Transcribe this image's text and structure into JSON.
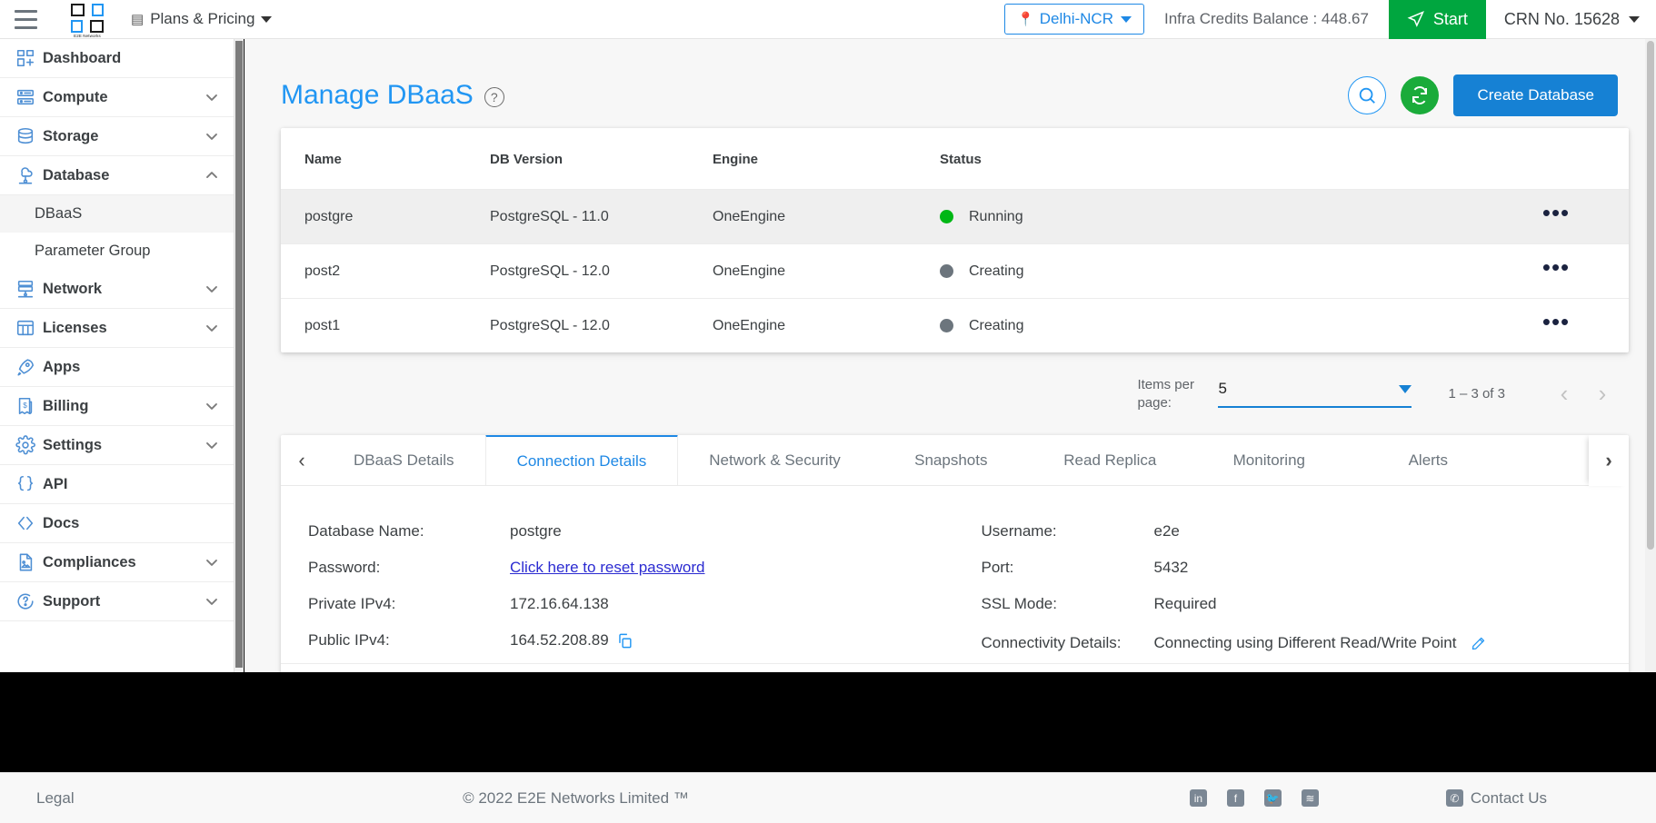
{
  "topbar": {
    "menu_icon": "hamburger-icon",
    "logo_caption": "E2E Networks",
    "plans_label": "Plans & Pricing",
    "region_label": "Delhi-NCR",
    "credits_label": "Infra Credits Balance : 448.67",
    "start_label": "Start",
    "crn_label": "CRN No. 15628"
  },
  "sidebar": {
    "items": [
      {
        "label": "Dashboard",
        "icon": "dashboard-icon",
        "expandable": false,
        "expanded": false
      },
      {
        "label": "Compute",
        "icon": "server-icon",
        "expandable": true,
        "expanded": false
      },
      {
        "label": "Storage",
        "icon": "storage-icon",
        "expandable": true,
        "expanded": false
      },
      {
        "label": "Database",
        "icon": "database-cloud-icon",
        "expandable": true,
        "expanded": true
      },
      {
        "label": "Network",
        "icon": "network-icon",
        "expandable": true,
        "expanded": false
      },
      {
        "label": "Licenses",
        "icon": "licenses-icon",
        "expandable": true,
        "expanded": false
      },
      {
        "label": "Apps",
        "icon": "rocket-icon",
        "expandable": false,
        "expanded": false
      },
      {
        "label": "Billing",
        "icon": "billing-icon",
        "expandable": true,
        "expanded": false
      },
      {
        "label": "Settings",
        "icon": "gear-icon",
        "expandable": true,
        "expanded": false
      },
      {
        "label": "API",
        "icon": "braces-icon",
        "expandable": false,
        "expanded": false
      },
      {
        "label": "Docs",
        "icon": "code-icon",
        "expandable": false,
        "expanded": false
      },
      {
        "label": "Compliances",
        "icon": "document-icon",
        "expandable": true,
        "expanded": false
      },
      {
        "label": "Support",
        "icon": "support-chat-icon",
        "expandable": true,
        "expanded": false
      }
    ],
    "database_children": [
      {
        "label": "DBaaS",
        "active": true
      },
      {
        "label": "Parameter Group",
        "active": false
      }
    ]
  },
  "page": {
    "title": "Manage DBaaS",
    "help_icon": "question-mark-icon",
    "search_icon": "search-icon",
    "refresh_icon": "refresh-icon",
    "create_label": "Create Database"
  },
  "table": {
    "columns": [
      "Name",
      "DB Version",
      "Engine",
      "Status"
    ],
    "rows": [
      {
        "name": "postgre",
        "db_version": "PostgreSQL - 11.0",
        "engine": "OneEngine",
        "status": "Running",
        "status_color": "#00b715",
        "selected": true
      },
      {
        "name": "post2",
        "db_version": "PostgreSQL - 12.0",
        "engine": "OneEngine",
        "status": "Creating",
        "status_color": "#6c757d",
        "selected": false
      },
      {
        "name": "post1",
        "db_version": "PostgreSQL - 12.0",
        "engine": "OneEngine",
        "status": "Creating",
        "status_color": "#6c757d",
        "selected": false
      }
    ],
    "row_menu_icon": "more-options-icon"
  },
  "paginator": {
    "items_per_page_label": "Items per page:",
    "items_per_page_value": "5",
    "range_label": "1 – 3 of 3",
    "prev_icon": "chevron-left-icon",
    "next_icon": "chevron-right-icon"
  },
  "tabs": {
    "prev_icon": "chevron-left-icon",
    "next_icon": "chevron-right-icon",
    "items": [
      {
        "label": "DBaaS Details",
        "active": false
      },
      {
        "label": "Connection Details",
        "active": true
      },
      {
        "label": "Network & Security",
        "active": false
      },
      {
        "label": "Snapshots",
        "active": false
      },
      {
        "label": "Read Replica",
        "active": false
      },
      {
        "label": "Monitoring",
        "active": false
      },
      {
        "label": "Alerts",
        "active": false
      }
    ]
  },
  "connection_details": {
    "left": [
      {
        "label": "Database Name:",
        "value": "postgre",
        "type": "text"
      },
      {
        "label": "Password:",
        "value": "Click here to reset password",
        "type": "link"
      },
      {
        "label": "Private IPv4:",
        "value": "172.16.64.138",
        "type": "text"
      },
      {
        "label": "Public IPv4:",
        "value": "164.52.208.89",
        "type": "copy"
      }
    ],
    "right": [
      {
        "label": "Username:",
        "value": "e2e",
        "type": "text"
      },
      {
        "label": "Port:",
        "value": "5432",
        "type": "text"
      },
      {
        "label": "SSL Mode:",
        "value": "Required",
        "type": "text"
      },
      {
        "label": "Connectivity Details:",
        "value": "Connecting using Different Read/Write Point",
        "type": "edit"
      }
    ]
  },
  "footer": {
    "legal": "Legal",
    "copyright": "© 2022 E2E Networks Limited ™",
    "social": [
      {
        "name": "linkedin-icon",
        "glyph": "in"
      },
      {
        "name": "facebook-icon",
        "glyph": "f"
      },
      {
        "name": "twitter-icon",
        "glyph": "🐦"
      },
      {
        "name": "rss-icon",
        "glyph": "≋"
      }
    ],
    "contact": "Contact Us",
    "contact_icon": "phone-icon"
  },
  "colors": {
    "accent_blue": "#2196f3",
    "brand_blue": "#1681d4",
    "green": "#00a63f",
    "status_running": "#00b715",
    "status_creating": "#6c757d"
  }
}
